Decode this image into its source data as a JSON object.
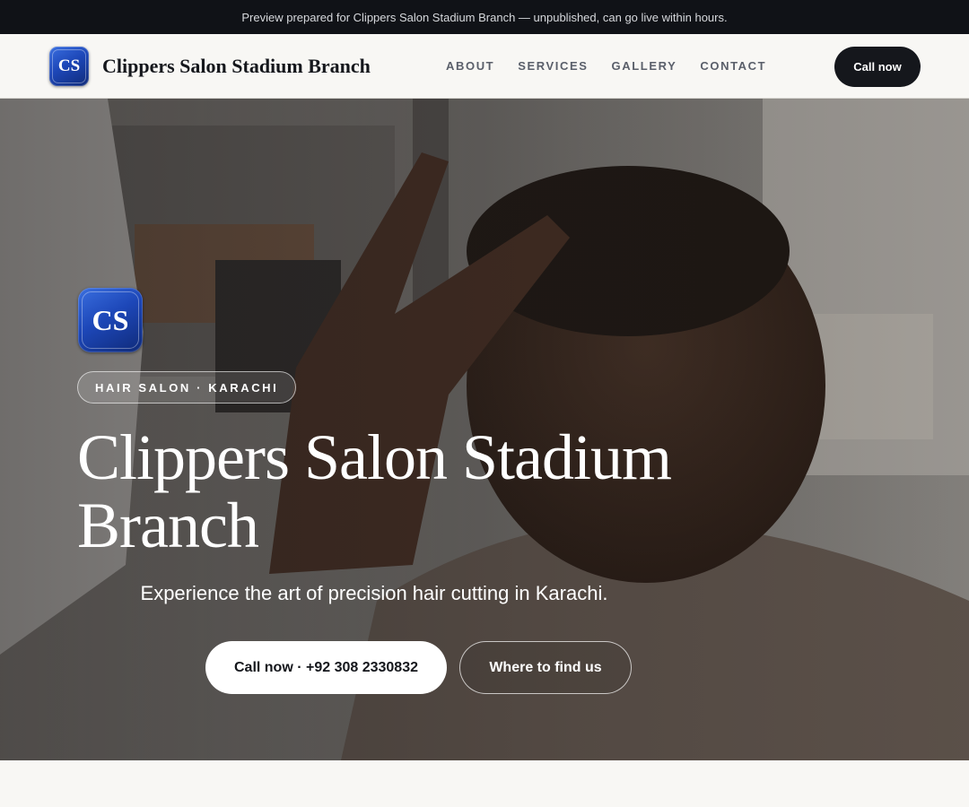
{
  "banner": {
    "text": "Preview prepared for Clippers Salon Stadium Branch — unpublished, can go live within hours."
  },
  "nav": {
    "logo_initials": "CS",
    "brand": "Clippers Salon Stadium Branch",
    "links": [
      "ABOUT",
      "SERVICES",
      "GALLERY",
      "CONTACT"
    ],
    "cta": "Call now"
  },
  "hero": {
    "logo_initials": "CS",
    "tag": "HAIR SALON · KARACHI",
    "title": "Clippers Salon Stadium Branch",
    "subtitle": "Experience the art of precision hair cutting in Karachi.",
    "primary_button": "Call now · +92 308 2330832",
    "secondary_button": "Where to find us"
  },
  "colors": {
    "dark": "#15171c",
    "banner_bg": "#101217",
    "page_bg": "#f8f7f4",
    "logo_blue": "#1d47b8"
  }
}
